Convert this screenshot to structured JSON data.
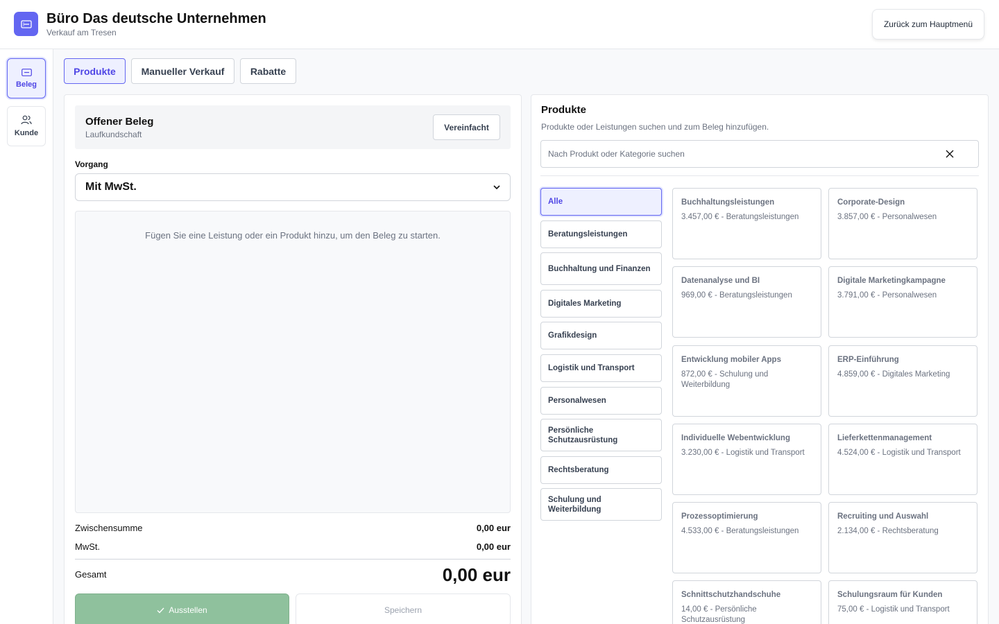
{
  "header": {
    "title": "Büro Das deutsche Unternehmen",
    "subtitle": "Verkauf am Tresen",
    "back_label": "Zurück zum Hauptmenü"
  },
  "rail": {
    "beleg": "Beleg",
    "kunde": "Kunde"
  },
  "tabs": [
    "Produkte",
    "Manueller Verkauf",
    "Rabatte"
  ],
  "receipt": {
    "title": "Offener Beleg",
    "customer": "Laufkundschaft",
    "mode_button": "Vereinfacht",
    "vorgang_label": "Vorgang",
    "vorgang_value": "Mit MwSt.",
    "empty_message": "Fügen Sie eine Leistung oder ein Produkt hinzu, um den Beleg zu starten.",
    "subtotal_label": "Zwischensumme",
    "subtotal_value": "0,00 eur",
    "tax_label": "MwSt.",
    "tax_value": "0,00 eur",
    "total_label": "Gesamt",
    "total_value": "0,00 eur",
    "issue_label": "Ausstellen",
    "save_label": "Speichern"
  },
  "products": {
    "title": "Produkte",
    "subtitle": "Produkte oder Leistungen suchen und zum Beleg hinzufügen.",
    "search_placeholder": "Nach Produkt oder Kategorie suchen",
    "categories": [
      "Alle",
      "Beratungsleistungen",
      "Buchhaltung und Finanzen",
      "Digitales Marketing",
      "Grafikdesign",
      "Logistik und Transport",
      "Personalwesen",
      "Persönliche Schutzausrüstung",
      "Rechtsberatung",
      "Schulung und Weiterbildung"
    ],
    "items": [
      {
        "name": "Buchhaltungsleistungen",
        "meta": "3.457,00 € - Beratungsleistungen"
      },
      {
        "name": "Corporate-Design",
        "meta": "3.857,00 € - Personalwesen"
      },
      {
        "name": "Datenanalyse und BI",
        "meta": "969,00 € - Beratungsleistungen"
      },
      {
        "name": "Digitale Marketingkampagne",
        "meta": "3.791,00 € - Personalwesen"
      },
      {
        "name": "Entwicklung mobiler Apps",
        "meta": "872,00 € - Schulung und Weiterbildung"
      },
      {
        "name": "ERP-Einführung",
        "meta": "4.859,00 € - Digitales Marketing"
      },
      {
        "name": "Individuelle Webentwicklung",
        "meta": "3.230,00 € - Logistik und Transport"
      },
      {
        "name": "Lieferkettenmanagement",
        "meta": "4.524,00 € - Logistik und Transport"
      },
      {
        "name": "Prozessoptimierung",
        "meta": "4.533,00 € - Beratungsleistungen"
      },
      {
        "name": "Recruiting und Auswahl",
        "meta": "2.134,00 € - Rechtsberatung"
      },
      {
        "name": "Schnittschutzhandschuhe",
        "meta": "14,00 € - Persönliche Schutzausrüstung"
      },
      {
        "name": "Schulungsraum für Kunden",
        "meta": "75,00 € - Logistik und Transport"
      }
    ]
  },
  "colors": {
    "accent": "#6366f1",
    "issue_green": "#8fc19d"
  }
}
